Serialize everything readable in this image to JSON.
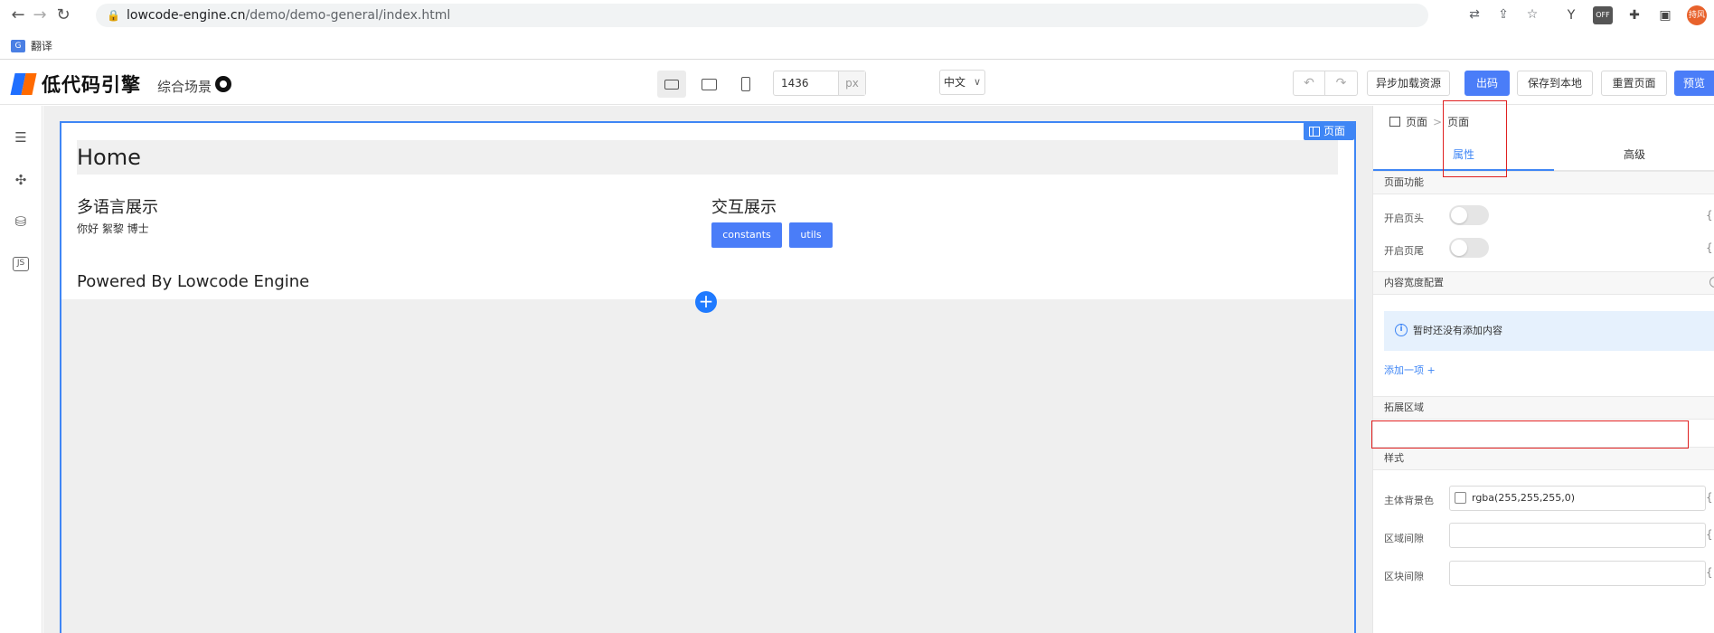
{
  "browser": {
    "url_host": "lowcode-engine.cn",
    "url_path": "/demo/demo-general/index.html",
    "bookmark_label": "翻译",
    "profile_label": "持风",
    "ext_off_label": "OFF"
  },
  "header": {
    "logo_text": "低代码引擎",
    "scene_label": "综合场景",
    "canvas_width": "1436",
    "width_unit": "px",
    "language": "中文",
    "buttons": {
      "async_load": "异步加载资源",
      "export_code": "出码",
      "save_local": "保存到本地",
      "reset_page": "重置页面",
      "preview": "预览"
    }
  },
  "canvas": {
    "page_tag": "页面",
    "home_title": "Home",
    "i18n_title": "多语言展示",
    "i18n_text": "你好  絮黎 博士",
    "interact_title": "交互展示",
    "btn_constants": "constants",
    "btn_utils": "utils",
    "powered_by": "Powered By Lowcode Engine"
  },
  "panel": {
    "crumb_1": "页面",
    "crumb_2": "页面",
    "tab_props": "属性",
    "tab_advanced": "高级",
    "group_page_feature": "页面功能",
    "label_header": "开启页头",
    "label_footer": "开启页尾",
    "group_content_width": "内容宽度配置",
    "empty_info": "暂时还没有添加内容",
    "add_item": "添加一项 +",
    "group_extension": "拓展区域",
    "group_style": "样式",
    "label_bg": "主体背景色",
    "bg_value": "rgba(255,255,255,0)",
    "label_area_gap": "区域间隙",
    "label_block_gap": "区块间隙",
    "var_mark": "{"
  },
  "colors": {
    "primary": "#4a7df8",
    "selection": "#3f86f5",
    "highlight": "#e02020"
  }
}
